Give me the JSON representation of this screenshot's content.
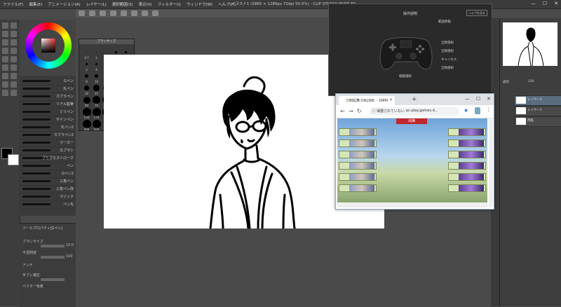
{
  "app": {
    "title_bar": "イラスト1 (1860 × 1280px 72dpi 50.0%) - CLIP STUDIO PAINT EX",
    "menu": [
      "ファイル(F)",
      "編集(E)",
      "アニメーション(A)",
      "レイヤー(L)",
      "選択範囲(S)",
      "表示(V)",
      "フィルター(I)",
      "ウィンドウ(W)",
      "ヘルプ(H)"
    ],
    "window_controls": [
      "—",
      "☐",
      "✕"
    ]
  },
  "brush_panel": {
    "brushes": [
      "Gペン",
      "丸ペン",
      "カブラペン",
      "リアル鉛筆",
      "ミリペン",
      "サインペン",
      "丸ペン2",
      "カブラペン2",
      "マーカー",
      "丸ブラシ",
      "ざらざらストローク",
      "ペン",
      "Gペン2",
      "三角ペン",
      "三角ペン改",
      "マジック",
      "ペン先"
    ]
  },
  "tool_property": {
    "title": "ツールプロパティ[Gペン]",
    "rows": [
      "ブラシサイズ",
      "不透明度",
      "アンチ",
      "手ブレ補正",
      "ベクター吸着"
    ],
    "size_value": "10.0",
    "opacity_value": "100"
  },
  "size_palette": {
    "title": "ブラシサイズ",
    "labels": [
      "0.7",
      "1",
      "1.5",
      "2",
      "2.5",
      "3",
      "4",
      "5",
      "6",
      "7",
      "8",
      "10",
      "12",
      "15",
      "17",
      "20",
      "25",
      "30",
      "40",
      "50",
      "60",
      "70",
      "80",
      "100",
      "120",
      "150",
      "170",
      "200",
      "250",
      "300",
      "400",
      "500"
    ]
  },
  "controller_dialog": {
    "title": "操作説明",
    "button": "ヘルプを見る",
    "annotations": [
      "範囲移動",
      "全隊選択",
      "全隊選択",
      "キャンセル",
      "全隊選択",
      "戦闘選択"
    ]
  },
  "layers": {
    "items": [
      "レイヤー2",
      "レイヤー1",
      "用紙"
    ],
    "blend": "通常",
    "opacity": "100"
  },
  "browser": {
    "tab_title": "刀剣乱舞-ONLINE- - DMM",
    "new_tab": "+",
    "url_security": "保護されていない",
    "url": "pc-play.games.d...",
    "battle_label": "出陣"
  },
  "colors": {
    "ui_dark": "#3b3b3b",
    "accent": "#5a6c80",
    "battle_red": "#c0262d"
  }
}
